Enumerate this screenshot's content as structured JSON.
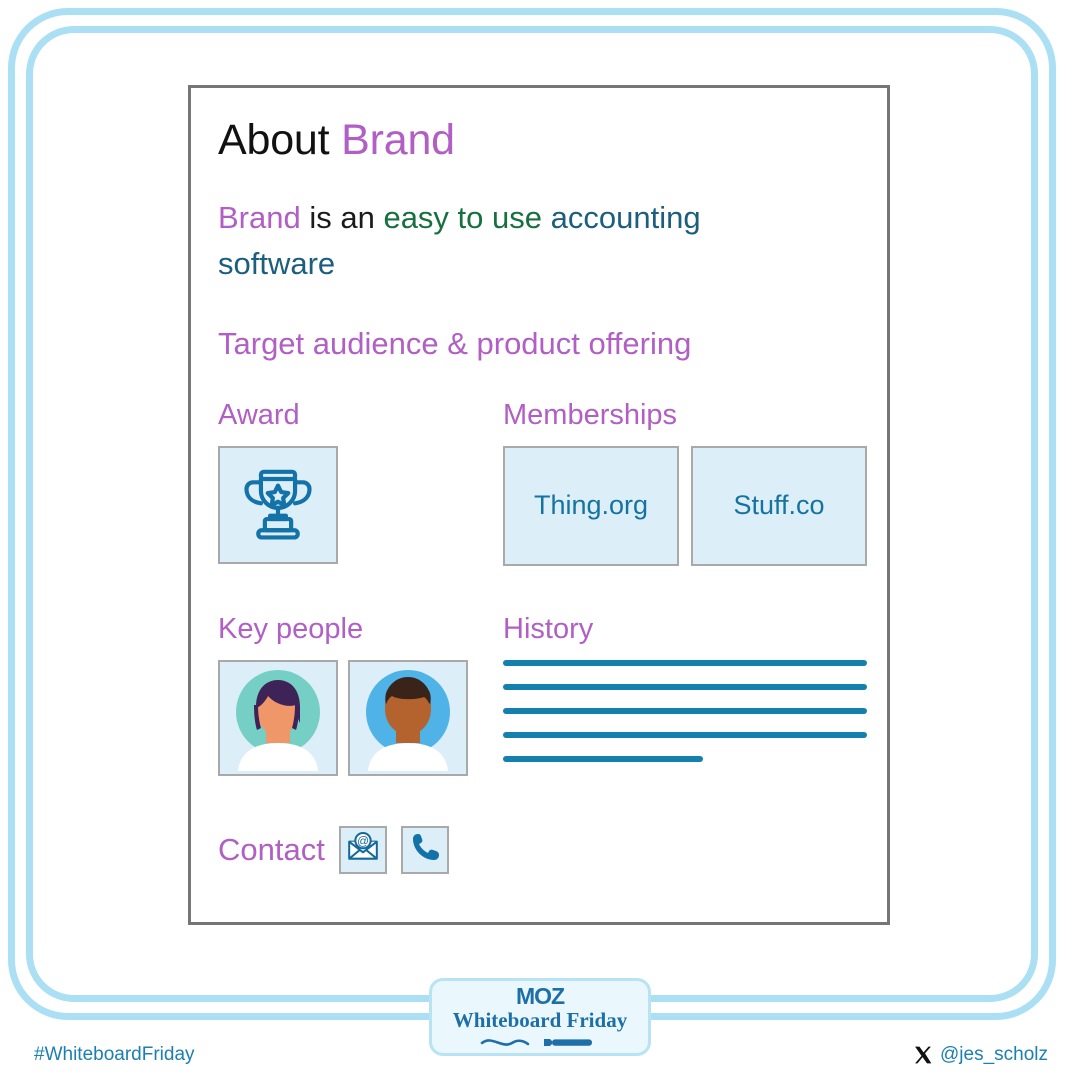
{
  "frame": {
    "border_color": "#ABDFF4"
  },
  "panel": {
    "border_color": "#767676",
    "title": {
      "static": "About ",
      "brand": "Brand"
    },
    "tagline": {
      "brand": "Brand",
      "mid": " is an ",
      "green": "easy to use",
      "space": " ",
      "blue": "accounting software"
    },
    "subhead": "Target audience & product offering",
    "sections": {
      "award": {
        "label": "Award",
        "icon": "trophy-icon"
      },
      "memberships": {
        "label": "Memberships",
        "items": [
          {
            "name": "Thing.org"
          },
          {
            "name": "Stuff.co"
          }
        ]
      },
      "key_people": {
        "label": "Key people",
        "items": [
          {
            "avatar": "avatar-woman"
          },
          {
            "avatar": "avatar-man"
          }
        ]
      },
      "history": {
        "label": "History",
        "lines": [
          {
            "width": "full"
          },
          {
            "width": "full"
          },
          {
            "width": "full"
          },
          {
            "width": "full"
          },
          {
            "width": "short"
          }
        ]
      },
      "contact": {
        "label": "Contact",
        "icons": [
          {
            "name": "email-icon"
          },
          {
            "name": "phone-icon"
          }
        ]
      }
    }
  },
  "badge": {
    "logo": "MOZ",
    "subtitle": "Whiteboard Friday"
  },
  "footer": {
    "hashtag": "#WhiteboardFriday",
    "handle": "@jes_scholz",
    "handle_icon": "x-logo-icon"
  },
  "colors": {
    "purple": "#B15FC4",
    "green": "#17713F",
    "blue": "#1B5E7E",
    "line_blue": "#1380AD",
    "tile_fill": "#DCEFF9",
    "tile_border": "#A9A9A9",
    "frame": "#ABDFF4",
    "footer_text": "#1B7FAF"
  }
}
